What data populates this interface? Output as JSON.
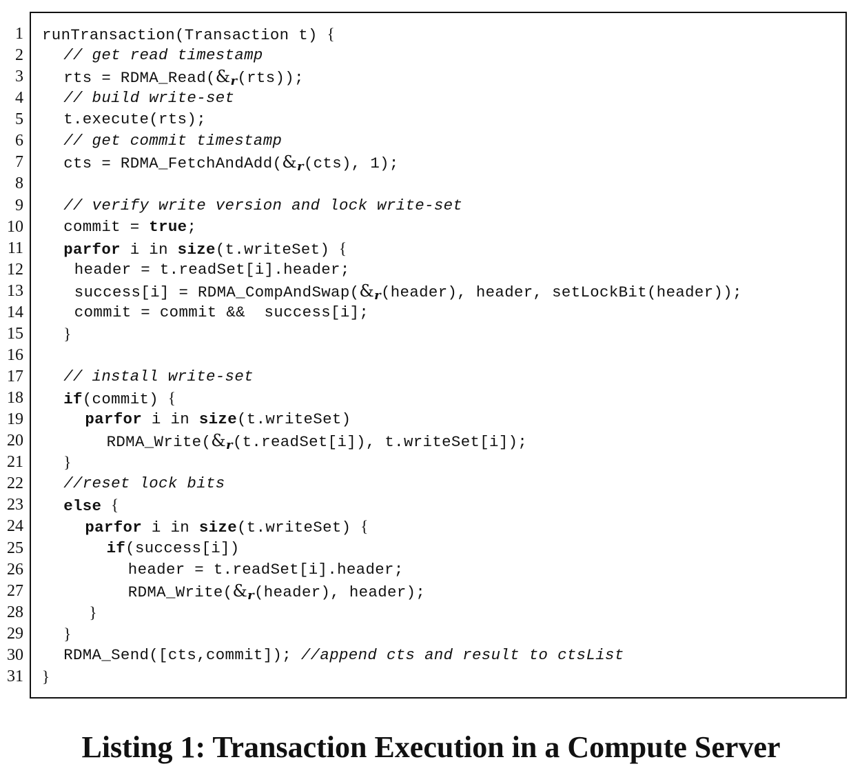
{
  "caption": "Listing 1: Transaction Execution in a Compute Server",
  "lines": [
    {
      "n": "1",
      "indent": 0,
      "tokens": [
        [
          "runTransaction(Transaction t) ",
          "t"
        ],
        [
          "{",
          "b"
        ]
      ]
    },
    {
      "n": "2",
      "indent": 2,
      "tokens": [
        [
          "// get read timestamp",
          "c"
        ]
      ]
    },
    {
      "n": "3",
      "indent": 2,
      "tokens": [
        [
          "rts = RDMA_Read(",
          "t"
        ],
        [
          "&",
          "a"
        ],
        [
          "r",
          "s"
        ],
        [
          "(rts));",
          "t"
        ]
      ]
    },
    {
      "n": "4",
      "indent": 2,
      "tokens": [
        [
          "// build write-set",
          "c"
        ]
      ]
    },
    {
      "n": "5",
      "indent": 2,
      "tokens": [
        [
          "t.execute(rts);",
          "t"
        ]
      ]
    },
    {
      "n": "6",
      "indent": 2,
      "tokens": [
        [
          "// get commit timestamp",
          "c"
        ]
      ]
    },
    {
      "n": "7",
      "indent": 2,
      "tokens": [
        [
          "cts = RDMA_FetchAndAdd(",
          "t"
        ],
        [
          "&",
          "a"
        ],
        [
          "r",
          "s"
        ],
        [
          "(cts), 1);",
          "t"
        ]
      ]
    },
    {
      "n": "8",
      "indent": 0,
      "tokens": []
    },
    {
      "n": "9",
      "indent": 2,
      "tokens": [
        [
          "// verify write version and lock write-set",
          "c"
        ]
      ]
    },
    {
      "n": "10",
      "indent": 2,
      "tokens": [
        [
          "commit = ",
          "t"
        ],
        [
          "true",
          "k"
        ],
        [
          ";",
          "t"
        ]
      ]
    },
    {
      "n": "11",
      "indent": 2,
      "tokens": [
        [
          "parfor",
          "k"
        ],
        [
          " i in ",
          "t"
        ],
        [
          "size",
          "k"
        ],
        [
          "(t.writeSet) ",
          "t"
        ],
        [
          "{",
          "b"
        ]
      ]
    },
    {
      "n": "12",
      "indent": 3,
      "tokens": [
        [
          "header = t.readSet[i].header;",
          "t"
        ]
      ]
    },
    {
      "n": "13",
      "indent": 3,
      "tokens": [
        [
          "success[i] = RDMA_CompAndSwap(",
          "t"
        ],
        [
          "&",
          "a"
        ],
        [
          "r",
          "s"
        ],
        [
          "(header), header, setLockBit(header));",
          "t"
        ]
      ]
    },
    {
      "n": "14",
      "indent": 3,
      "tokens": [
        [
          "commit = commit &&  success[i];",
          "t"
        ]
      ]
    },
    {
      "n": "15",
      "indent": 2,
      "tokens": [
        [
          "}",
          "b"
        ]
      ]
    },
    {
      "n": "16",
      "indent": 0,
      "tokens": []
    },
    {
      "n": "17",
      "indent": 2,
      "tokens": [
        [
          "// install write-set",
          "c"
        ]
      ]
    },
    {
      "n": "18",
      "indent": 2,
      "tokens": [
        [
          "if",
          "k"
        ],
        [
          "(commit) ",
          "t"
        ],
        [
          "{",
          "b"
        ]
      ]
    },
    {
      "n": "19",
      "indent": 4,
      "tokens": [
        [
          "parfor",
          "k"
        ],
        [
          " i in ",
          "t"
        ],
        [
          "size",
          "k"
        ],
        [
          "(t.writeSet)",
          "t"
        ]
      ]
    },
    {
      "n": "20",
      "indent": 6,
      "tokens": [
        [
          "RDMA_Write(",
          "t"
        ],
        [
          "&",
          "a"
        ],
        [
          "r",
          "s"
        ],
        [
          "(t.readSet[i]), t.writeSet[i]);",
          "t"
        ]
      ]
    },
    {
      "n": "21",
      "indent": 2,
      "tokens": [
        [
          "}",
          "b"
        ]
      ]
    },
    {
      "n": "22",
      "indent": 2,
      "tokens": [
        [
          "//reset lock bits",
          "c"
        ]
      ]
    },
    {
      "n": "23",
      "indent": 2,
      "tokens": [
        [
          "else",
          "k"
        ],
        [
          " ",
          "t"
        ],
        [
          "{",
          "b"
        ]
      ]
    },
    {
      "n": "24",
      "indent": 4,
      "tokens": [
        [
          "parfor",
          "k"
        ],
        [
          " i in ",
          "t"
        ],
        [
          "size",
          "k"
        ],
        [
          "(t.writeSet) ",
          "t"
        ],
        [
          "{",
          "b"
        ]
      ]
    },
    {
      "n": "25",
      "indent": 6,
      "tokens": [
        [
          "if",
          "k"
        ],
        [
          "(success[i])",
          "t"
        ]
      ]
    },
    {
      "n": "26",
      "indent": 8,
      "tokens": [
        [
          "header = t.readSet[i].header;",
          "t"
        ]
      ]
    },
    {
      "n": "27",
      "indent": 8,
      "tokens": [
        [
          "RDMA_Write(",
          "t"
        ],
        [
          "&",
          "a"
        ],
        [
          "r",
          "s"
        ],
        [
          "(header), header);",
          "t"
        ]
      ]
    },
    {
      "n": "28",
      "indent": 4,
      "tokens": [
        [
          " }",
          "b"
        ]
      ]
    },
    {
      "n": "29",
      "indent": 2,
      "tokens": [
        [
          "}",
          "b"
        ]
      ]
    },
    {
      "n": "30",
      "indent": 2,
      "tokens": [
        [
          "RDMA_Send([cts,commit]); ",
          "t"
        ],
        [
          "//append cts and result to ctsList",
          "c"
        ]
      ]
    },
    {
      "n": "31",
      "indent": 0,
      "tokens": [
        [
          "}",
          "b"
        ]
      ]
    }
  ]
}
